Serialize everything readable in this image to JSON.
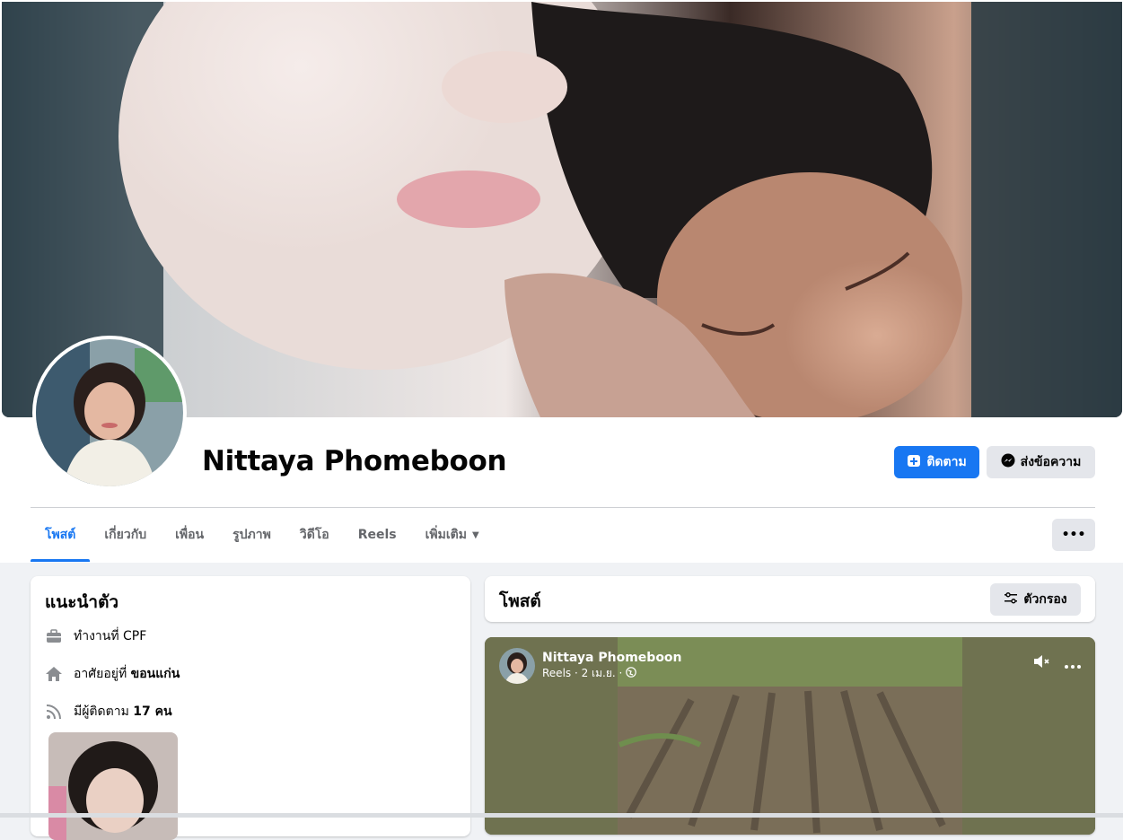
{
  "profile": {
    "name": "Nittaya Phomeboon"
  },
  "actions": {
    "follow_label": "ติดตาม",
    "message_label": "ส่งข้อความ",
    "more_label": "•••"
  },
  "tabs": [
    {
      "label": "โพสต์",
      "active": true
    },
    {
      "label": "เกี่ยวกับ"
    },
    {
      "label": "เพื่อน"
    },
    {
      "label": "รูปภาพ"
    },
    {
      "label": "วิดีโอ"
    },
    {
      "label": "Reels"
    },
    {
      "label": "เพิ่มเติม"
    }
  ],
  "intro": {
    "title": "แนะนำตัว",
    "work": "ทำงานที่ CPF",
    "lives_prefix": "อาศัยอยู่ที่ ",
    "lives_place": "ขอนแก่น",
    "followers_prefix": "มีผู้ติดตาม ",
    "followers_count": "17 คน"
  },
  "posts": {
    "title": "โพสต์",
    "filter_label": "ตัวกรอง"
  },
  "reel": {
    "author": "Nittaya Phomeboon",
    "meta": "Reels · 2 เม.ย. ·"
  },
  "colors": {
    "accent": "#1877f2",
    "secondary_button": "#e4e6eb",
    "page_bg": "#f0f2f5"
  },
  "icons": {
    "follow": "add-friend-icon",
    "message": "messenger-icon",
    "work": "briefcase-icon",
    "home": "home-icon",
    "followers": "rss-icon",
    "filter": "sliders-icon",
    "mute": "speaker-muted-icon",
    "privacy": "globe-icon"
  }
}
